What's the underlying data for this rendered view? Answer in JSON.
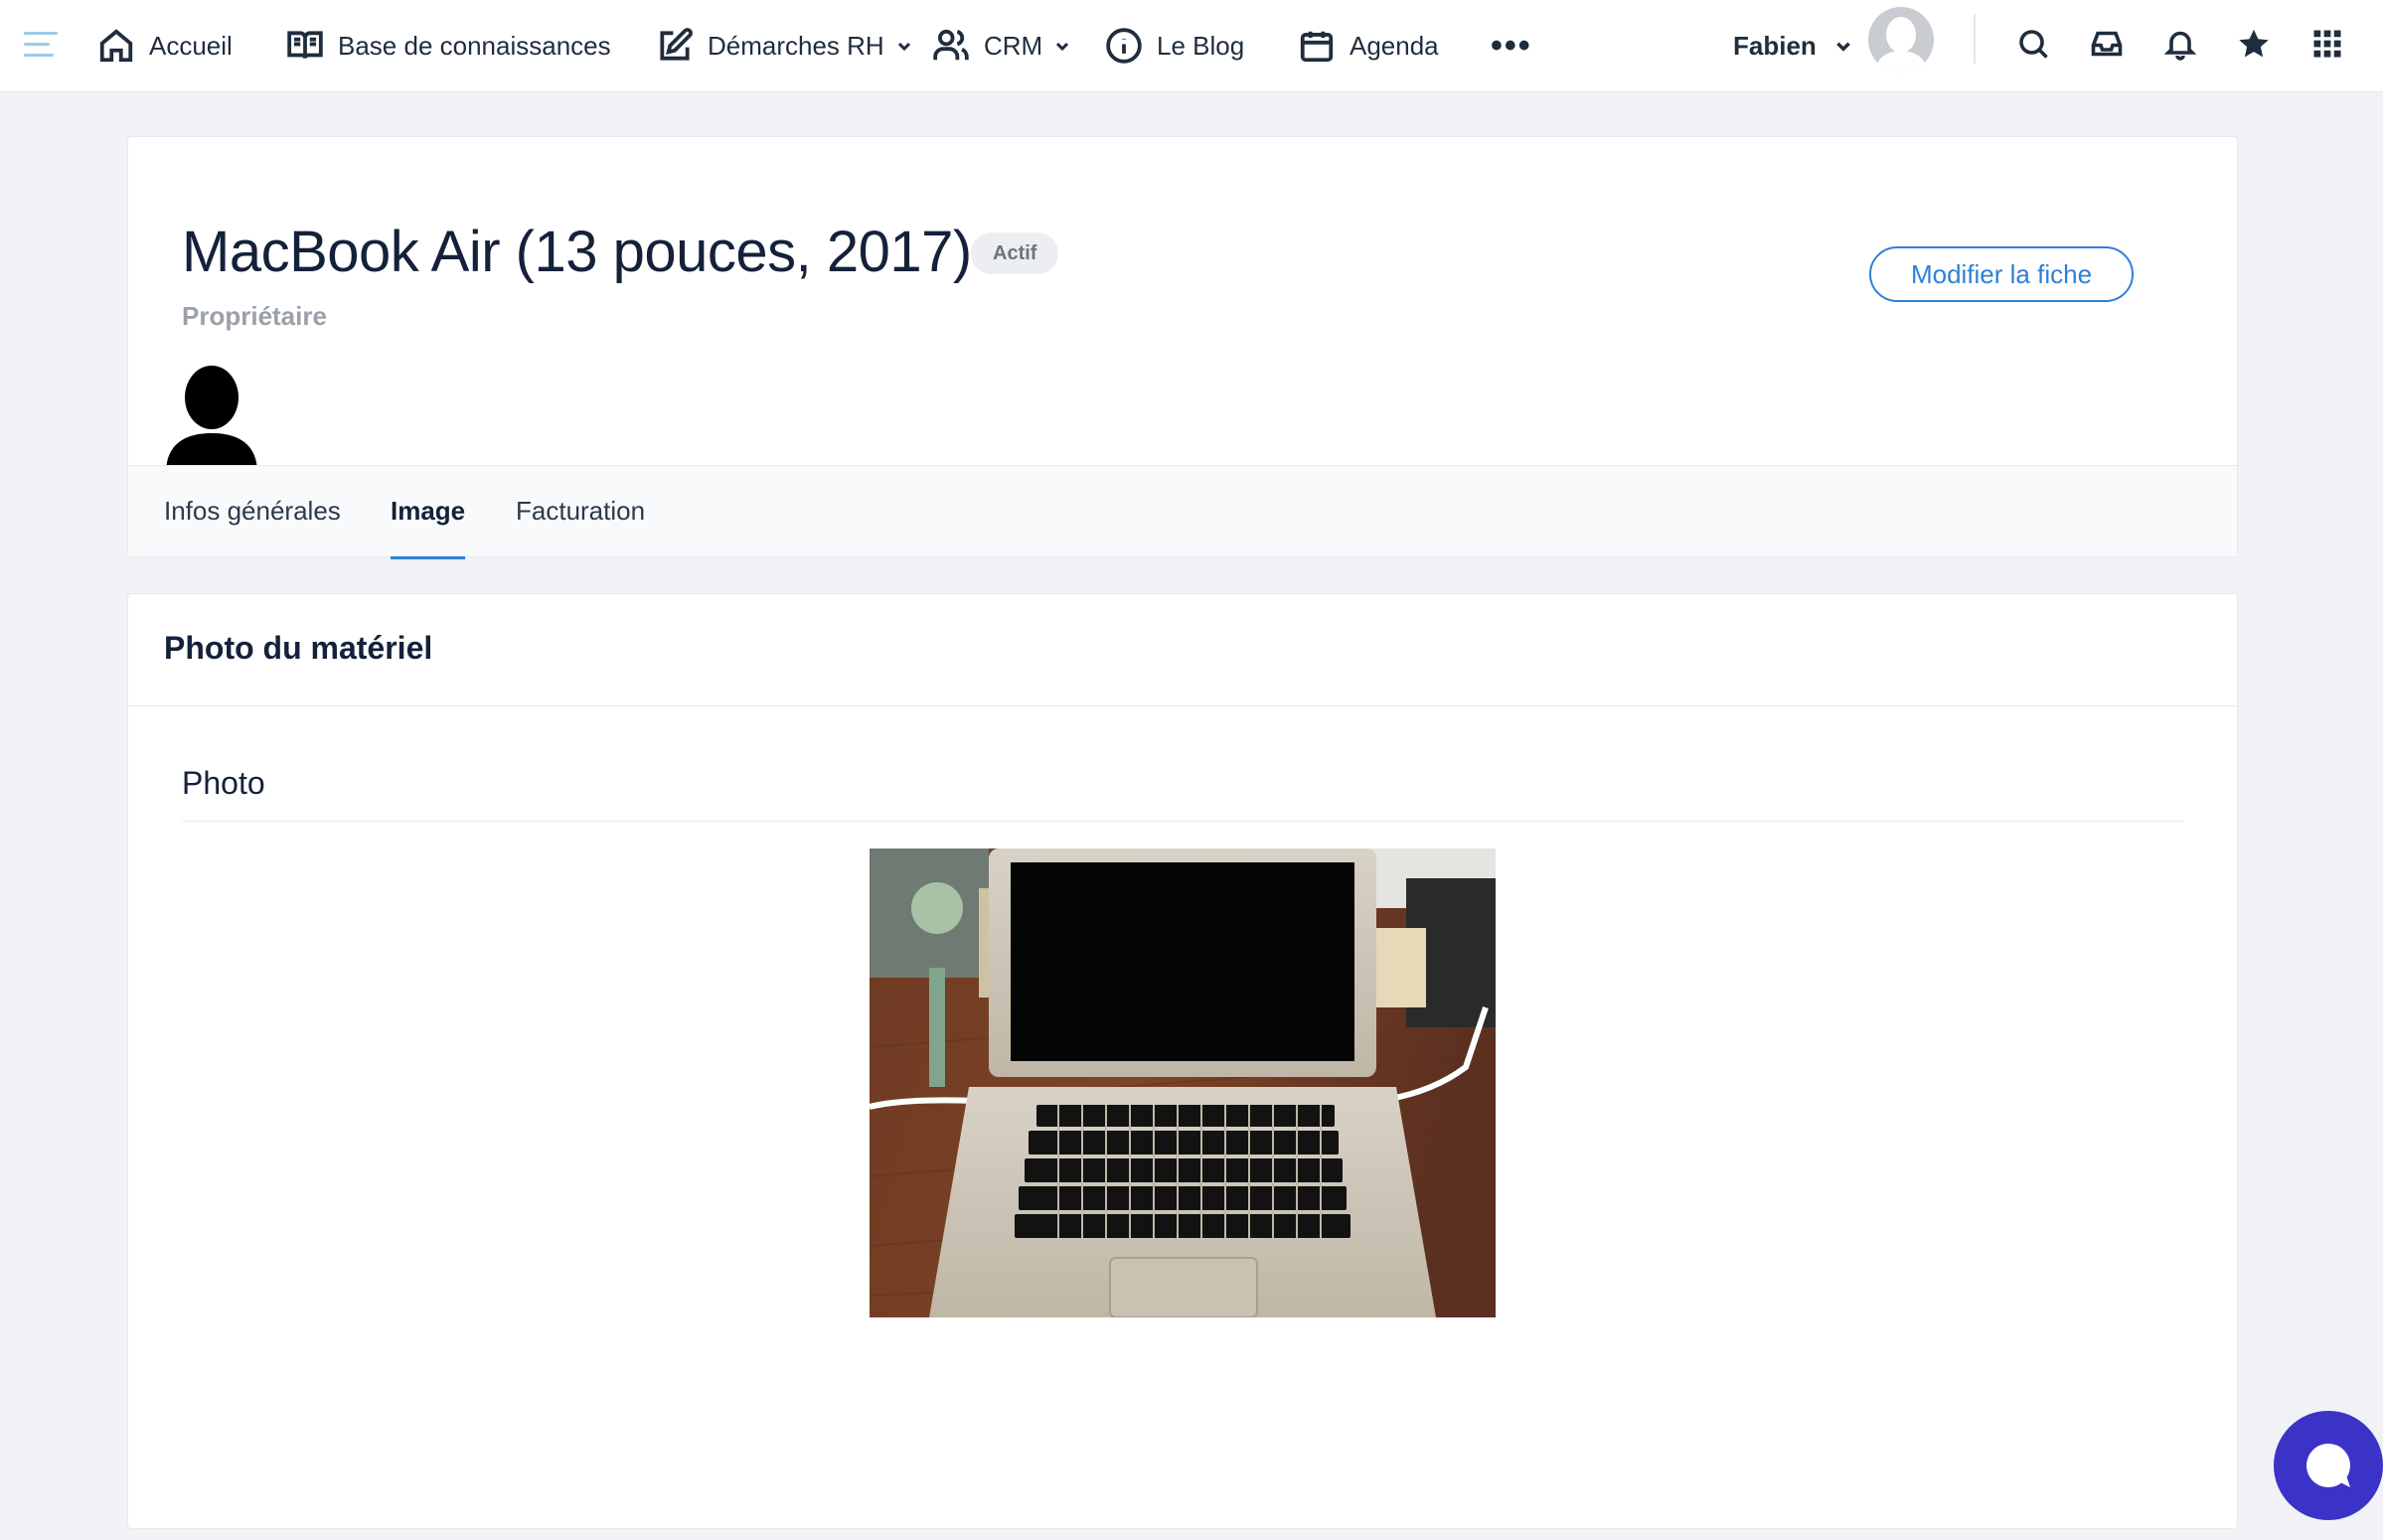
{
  "nav": {
    "items": [
      {
        "label": "Accueil",
        "icon": "home-icon"
      },
      {
        "label": "Base de connaissances",
        "icon": "book-icon"
      },
      {
        "label": "Démarches RH",
        "icon": "edit-icon",
        "dropdown": true
      },
      {
        "label": "CRM",
        "icon": "users-icon",
        "dropdown": true
      },
      {
        "label": "Le Blog",
        "icon": "info-icon"
      },
      {
        "label": "Agenda",
        "icon": "calendar-icon"
      }
    ],
    "more": "•••",
    "user_name": "Fabien",
    "tools": [
      "search-icon",
      "inbox-icon",
      "bell-icon",
      "star-icon",
      "apps-grid-icon"
    ]
  },
  "asset": {
    "title": "MacBook Air (13 pouces, 2017)",
    "status": "Actif",
    "owner_label": "Propriétaire",
    "edit_button": "Modifier la fiche"
  },
  "tabs": [
    {
      "label": "Infos générales",
      "active": false
    },
    {
      "label": "Image",
      "active": true
    },
    {
      "label": "Facturation",
      "active": false
    }
  ],
  "photo_section": {
    "title": "Photo du matériel",
    "field_label": "Photo"
  },
  "colors": {
    "accent": "#2f7fd9",
    "chat": "#3b32c8",
    "menu_toggle": "#9ec9e6"
  }
}
